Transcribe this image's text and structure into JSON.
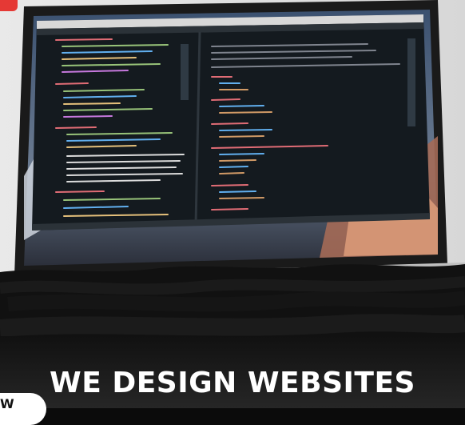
{
  "headline": "WE DESIGN WEBSITES",
  "badge_text": "W",
  "colors": {
    "brush_overlay": "#111111",
    "headline_text": "#ffffff",
    "accent_red": "#e53935",
    "editor_bg": "#141a1f"
  },
  "photo": {
    "subject": "laptop-with-code-editor",
    "editor_panes": 2
  }
}
